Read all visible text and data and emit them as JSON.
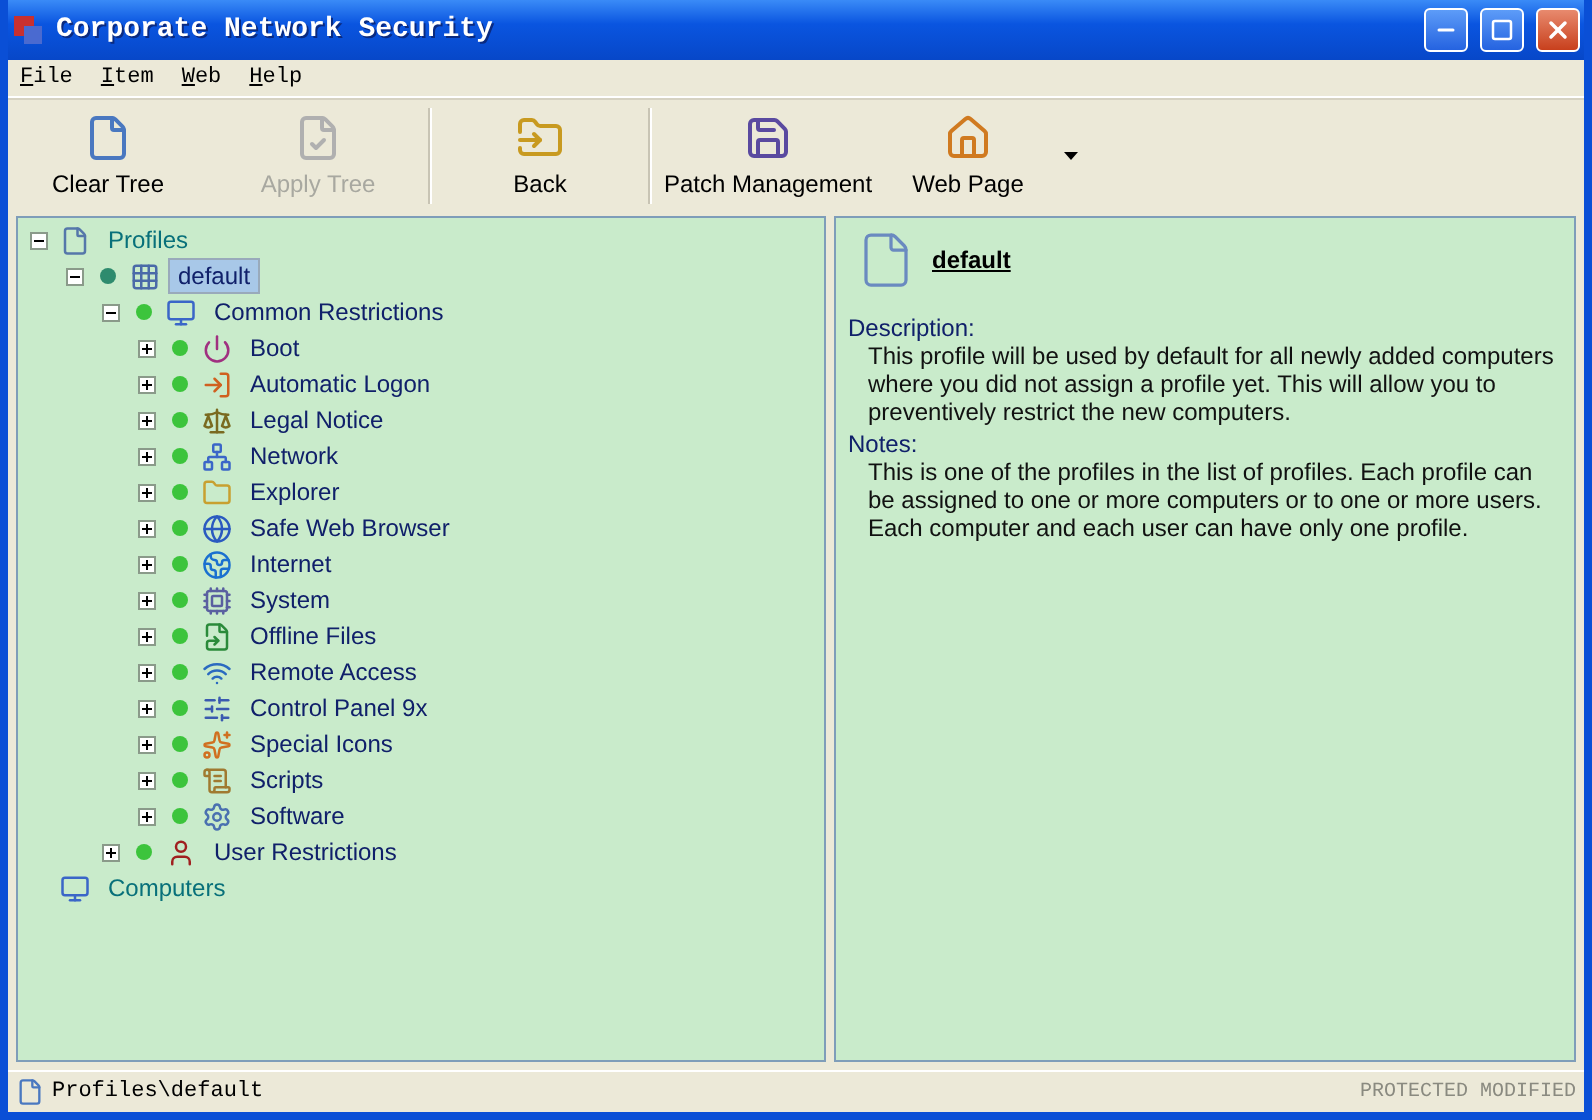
{
  "window": {
    "title": "Corporate Network Security"
  },
  "menu": [
    {
      "label": "File"
    },
    {
      "label": "Item"
    },
    {
      "label": "Web"
    },
    {
      "label": "Help"
    }
  ],
  "toolbar": [
    {
      "label": "Clear Tree",
      "disabled": false
    },
    {
      "label": "Apply Tree",
      "disabled": true
    },
    {
      "label": "Back",
      "disabled": false
    },
    {
      "label": "Patch Management",
      "disabled": false
    },
    {
      "label": "Web Page",
      "disabled": false
    }
  ],
  "tree": [
    {
      "label": "Profiles",
      "expanded": true,
      "selected": false,
      "children": [
        {
          "label": "default",
          "expanded": true,
          "selected": true,
          "color": "#2e8b6e",
          "children": [
            {
              "label": "Common Restrictions",
              "expanded": true,
              "selected": false,
              "color": "#3cc43c",
              "children": [
                {
                  "label": "Boot",
                  "expanded": false,
                  "selected": false,
                  "color": "#3cc43c"
                },
                {
                  "label": "Automatic Logon",
                  "expanded": false,
                  "selected": false,
                  "color": "#3cc43c"
                },
                {
                  "label": "Legal Notice",
                  "expanded": false,
                  "selected": false,
                  "color": "#3cc43c"
                },
                {
                  "label": "Network",
                  "expanded": false,
                  "selected": false,
                  "color": "#3cc43c"
                },
                {
                  "label": "Explorer",
                  "expanded": false,
                  "selected": false,
                  "color": "#3cc43c"
                },
                {
                  "label": "Safe Web Browser",
                  "expanded": false,
                  "selected": false,
                  "color": "#3cc43c"
                },
                {
                  "label": "Internet",
                  "expanded": false,
                  "selected": false,
                  "color": "#3cc43c"
                },
                {
                  "label": "System",
                  "expanded": false,
                  "selected": false,
                  "color": "#3cc43c"
                },
                {
                  "label": "Offline Files",
                  "expanded": false,
                  "selected": false,
                  "color": "#3cc43c"
                },
                {
                  "label": "Remote Access",
                  "expanded": false,
                  "selected": false,
                  "color": "#3cc43c"
                },
                {
                  "label": "Control Panel 9x",
                  "expanded": false,
                  "selected": false,
                  "color": "#3cc43c"
                },
                {
                  "label": "Special Icons",
                  "expanded": false,
                  "selected": false,
                  "color": "#3cc43c"
                },
                {
                  "label": "Scripts",
                  "expanded": false,
                  "selected": false,
                  "color": "#3cc43c"
                },
                {
                  "label": "Software",
                  "expanded": false,
                  "selected": false,
                  "color": "#3cc43c"
                }
              ]
            },
            {
              "label": "User Restrictions",
              "expanded": false,
              "selected": false,
              "color": "#3cc43c"
            }
          ]
        }
      ]
    },
    {
      "label": "Computers",
      "selected": false
    }
  ],
  "details": {
    "title": "default",
    "sections": [
      {
        "heading": "Description:",
        "text": "This profile will be used by default for all newly added computers where you did not assign a profile yet. This will allow you to preventively restrict the new computers."
      },
      {
        "heading": "Notes:",
        "text": "This is one of the profiles in the list of profiles. Each profile can be assigned to one or more computers or to one or more users. Each computer and each user can have only one profile."
      }
    ]
  },
  "status_bar": {
    "path": "Profiles\\default",
    "flags": "PROTECTED MODIFIED"
  }
}
